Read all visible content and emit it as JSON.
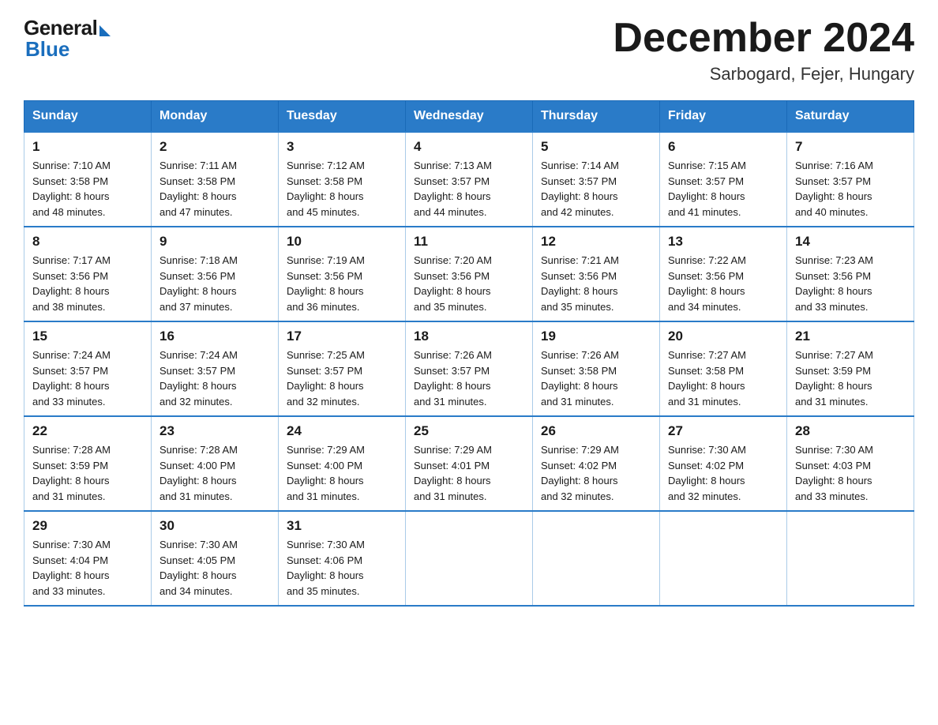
{
  "header": {
    "logo_general": "General",
    "logo_blue": "Blue",
    "month_title": "December 2024",
    "location": "Sarbogard, Fejer, Hungary"
  },
  "days_of_week": [
    "Sunday",
    "Monday",
    "Tuesday",
    "Wednesday",
    "Thursday",
    "Friday",
    "Saturday"
  ],
  "weeks": [
    [
      {
        "day": "1",
        "sunrise": "7:10 AM",
        "sunset": "3:58 PM",
        "daylight": "8 hours and 48 minutes."
      },
      {
        "day": "2",
        "sunrise": "7:11 AM",
        "sunset": "3:58 PM",
        "daylight": "8 hours and 47 minutes."
      },
      {
        "day": "3",
        "sunrise": "7:12 AM",
        "sunset": "3:58 PM",
        "daylight": "8 hours and 45 minutes."
      },
      {
        "day": "4",
        "sunrise": "7:13 AM",
        "sunset": "3:57 PM",
        "daylight": "8 hours and 44 minutes."
      },
      {
        "day": "5",
        "sunrise": "7:14 AM",
        "sunset": "3:57 PM",
        "daylight": "8 hours and 42 minutes."
      },
      {
        "day": "6",
        "sunrise": "7:15 AM",
        "sunset": "3:57 PM",
        "daylight": "8 hours and 41 minutes."
      },
      {
        "day": "7",
        "sunrise": "7:16 AM",
        "sunset": "3:57 PM",
        "daylight": "8 hours and 40 minutes."
      }
    ],
    [
      {
        "day": "8",
        "sunrise": "7:17 AM",
        "sunset": "3:56 PM",
        "daylight": "8 hours and 38 minutes."
      },
      {
        "day": "9",
        "sunrise": "7:18 AM",
        "sunset": "3:56 PM",
        "daylight": "8 hours and 37 minutes."
      },
      {
        "day": "10",
        "sunrise": "7:19 AM",
        "sunset": "3:56 PM",
        "daylight": "8 hours and 36 minutes."
      },
      {
        "day": "11",
        "sunrise": "7:20 AM",
        "sunset": "3:56 PM",
        "daylight": "8 hours and 35 minutes."
      },
      {
        "day": "12",
        "sunrise": "7:21 AM",
        "sunset": "3:56 PM",
        "daylight": "8 hours and 35 minutes."
      },
      {
        "day": "13",
        "sunrise": "7:22 AM",
        "sunset": "3:56 PM",
        "daylight": "8 hours and 34 minutes."
      },
      {
        "day": "14",
        "sunrise": "7:23 AM",
        "sunset": "3:56 PM",
        "daylight": "8 hours and 33 minutes."
      }
    ],
    [
      {
        "day": "15",
        "sunrise": "7:24 AM",
        "sunset": "3:57 PM",
        "daylight": "8 hours and 33 minutes."
      },
      {
        "day": "16",
        "sunrise": "7:24 AM",
        "sunset": "3:57 PM",
        "daylight": "8 hours and 32 minutes."
      },
      {
        "day": "17",
        "sunrise": "7:25 AM",
        "sunset": "3:57 PM",
        "daylight": "8 hours and 32 minutes."
      },
      {
        "day": "18",
        "sunrise": "7:26 AM",
        "sunset": "3:57 PM",
        "daylight": "8 hours and 31 minutes."
      },
      {
        "day": "19",
        "sunrise": "7:26 AM",
        "sunset": "3:58 PM",
        "daylight": "8 hours and 31 minutes."
      },
      {
        "day": "20",
        "sunrise": "7:27 AM",
        "sunset": "3:58 PM",
        "daylight": "8 hours and 31 minutes."
      },
      {
        "day": "21",
        "sunrise": "7:27 AM",
        "sunset": "3:59 PM",
        "daylight": "8 hours and 31 minutes."
      }
    ],
    [
      {
        "day": "22",
        "sunrise": "7:28 AM",
        "sunset": "3:59 PM",
        "daylight": "8 hours and 31 minutes."
      },
      {
        "day": "23",
        "sunrise": "7:28 AM",
        "sunset": "4:00 PM",
        "daylight": "8 hours and 31 minutes."
      },
      {
        "day": "24",
        "sunrise": "7:29 AM",
        "sunset": "4:00 PM",
        "daylight": "8 hours and 31 minutes."
      },
      {
        "day": "25",
        "sunrise": "7:29 AM",
        "sunset": "4:01 PM",
        "daylight": "8 hours and 31 minutes."
      },
      {
        "day": "26",
        "sunrise": "7:29 AM",
        "sunset": "4:02 PM",
        "daylight": "8 hours and 32 minutes."
      },
      {
        "day": "27",
        "sunrise": "7:30 AM",
        "sunset": "4:02 PM",
        "daylight": "8 hours and 32 minutes."
      },
      {
        "day": "28",
        "sunrise": "7:30 AM",
        "sunset": "4:03 PM",
        "daylight": "8 hours and 33 minutes."
      }
    ],
    [
      {
        "day": "29",
        "sunrise": "7:30 AM",
        "sunset": "4:04 PM",
        "daylight": "8 hours and 33 minutes."
      },
      {
        "day": "30",
        "sunrise": "7:30 AM",
        "sunset": "4:05 PM",
        "daylight": "8 hours and 34 minutes."
      },
      {
        "day": "31",
        "sunrise": "7:30 AM",
        "sunset": "4:06 PM",
        "daylight": "8 hours and 35 minutes."
      },
      null,
      null,
      null,
      null
    ]
  ],
  "labels": {
    "sunrise": "Sunrise:",
    "sunset": "Sunset:",
    "daylight": "Daylight:"
  }
}
